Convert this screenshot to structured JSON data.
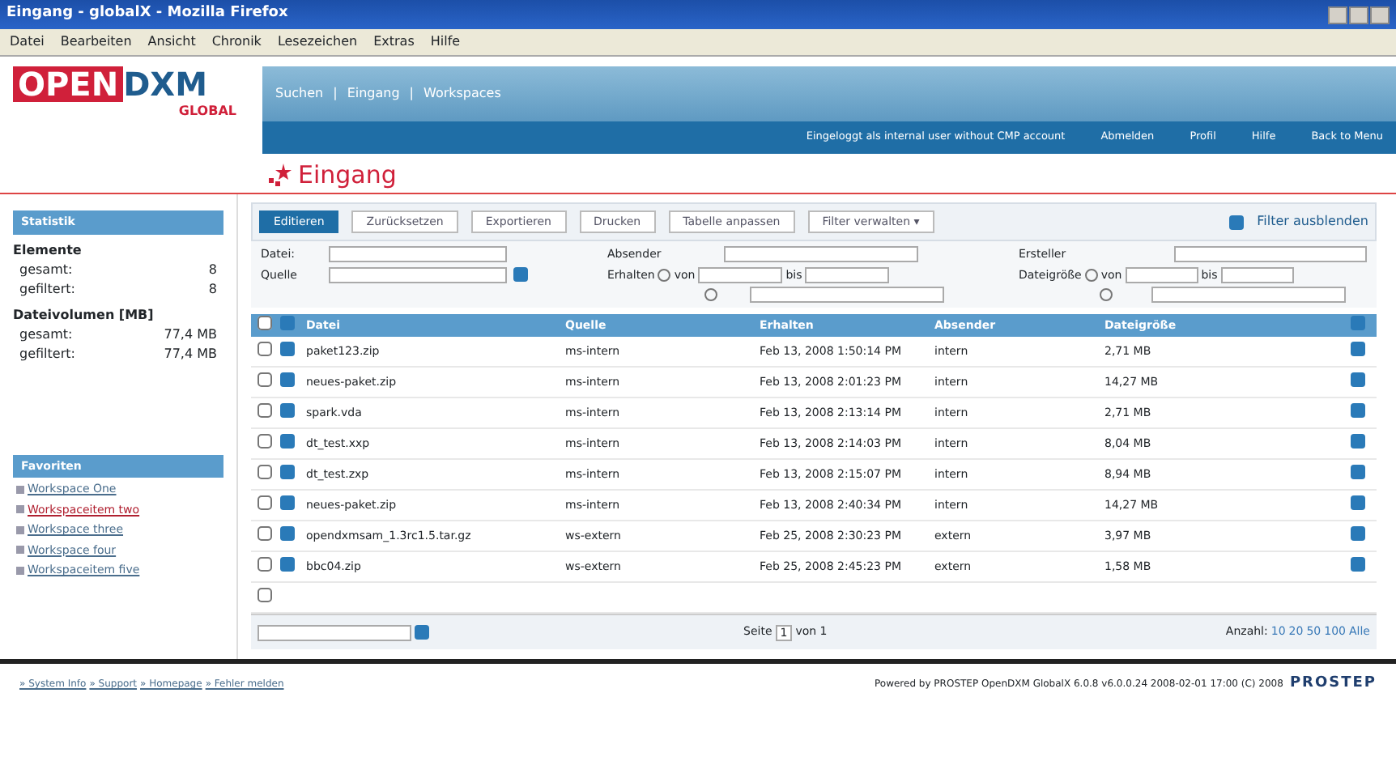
{
  "window": {
    "title": "Eingang - globalX - Mozilla Firefox"
  },
  "menu": [
    "Datei",
    "Bearbeiten",
    "Ansicht",
    "Chronik",
    "Lesezeichen",
    "Extras",
    "Hilfe"
  ],
  "logo": {
    "main": "OPEN",
    "accent": "DXM",
    "sub": "GLOBAL"
  },
  "top_nav": [
    "Suchen",
    "Eingang",
    "Workspaces"
  ],
  "top_nav_separators": [
    "|",
    "|"
  ],
  "user_bar": {
    "login": "Eingeloggt als internal user without CMP account",
    "links": [
      "Abmelden",
      "Profil",
      "Hilfe",
      "Back to Menu"
    ]
  },
  "page_title": "Eingang",
  "sidebar": {
    "statistics": {
      "title": "Statistik",
      "groups": [
        {
          "label": "Elemente",
          "rows": [
            {
              "label": "gesamt:",
              "value": "8"
            },
            {
              "label": "gefiltert:",
              "value": "8"
            }
          ]
        },
        {
          "label": "Dateivolumen [MB]",
          "rows": [
            {
              "label": "gesamt:",
              "value": "77,4 MB"
            },
            {
              "label": "gefiltert:",
              "value": "77,4 MB"
            }
          ]
        }
      ]
    },
    "favorites": {
      "title": "Favoriten",
      "items": [
        {
          "label": "Workspace One",
          "selected": false
        },
        {
          "label": "Workspaceitem two",
          "selected": true
        },
        {
          "label": "Workspace three",
          "selected": false
        },
        {
          "label": "Workspace four",
          "selected": false
        },
        {
          "label": "Workspaceitem five",
          "selected": false
        }
      ]
    }
  },
  "toolbar": {
    "buttons": [
      {
        "label": "Editieren",
        "selected": true
      },
      {
        "label": "Zurücksetzen",
        "selected": false
      },
      {
        "label": "Exportieren",
        "selected": false
      },
      {
        "label": "Drucken",
        "selected": false
      },
      {
        "label": "Tabelle anpassen",
        "selected": false
      },
      {
        "label": "Filter verwalten ▾",
        "selected": false
      }
    ],
    "toggle": "Filter ausblenden"
  },
  "filters": {
    "datei": "Datei:",
    "quelle": "Quelle",
    "absender": "Absender",
    "erhalten": "Erhalten",
    "von": "von",
    "bis": "bis",
    "ersteller": "Ersteller",
    "dateigroesse": "Dateigröße",
    "groesse_von": "von",
    "groesse_bis": "bis",
    "erhalten_radios": [
      {
        "selected": false
      },
      {
        "selected": false
      }
    ],
    "groesse_radios": [
      {
        "selected": false
      },
      {
        "selected": false
      }
    ]
  },
  "table": {
    "select_all_checked": false,
    "empty_row_checked": false,
    "columns": [
      "Datei",
      "Quelle",
      "Erhalten",
      "Absender",
      "Dateigröße"
    ],
    "rows": [
      {
        "checked": false,
        "cells": [
          "paket123.zip",
          "ms-intern",
          "Feb 13, 2008 1:50:14 PM",
          "intern",
          "2,71 MB"
        ]
      },
      {
        "checked": false,
        "cells": [
          "neues-paket.zip",
          "ms-intern",
          "Feb 13, 2008 2:01:23 PM",
          "intern",
          "14,27 MB"
        ]
      },
      {
        "checked": false,
        "cells": [
          "spark.vda",
          "ms-intern",
          "Feb 13, 2008 2:13:14 PM",
          "intern",
          "2,71 MB"
        ]
      },
      {
        "checked": false,
        "cells": [
          "dt_test.xxp",
          "ms-intern",
          "Feb 13, 2008 2:14:03 PM",
          "intern",
          "8,04 MB"
        ]
      },
      {
        "checked": false,
        "cells": [
          "dt_test.zxp",
          "ms-intern",
          "Feb 13, 2008 2:15:07 PM",
          "intern",
          "8,94 MB"
        ]
      },
      {
        "checked": false,
        "cells": [
          "neues-paket.zip",
          "ms-intern",
          "Feb 13, 2008 2:40:34 PM",
          "intern",
          "14,27 MB"
        ]
      },
      {
        "checked": false,
        "cells": [
          "opendxmsam_1.3rc1.5.tar.gz",
          "ws-extern",
          "Feb 25, 2008 2:30:23 PM",
          "extern",
          "3,97 MB"
        ]
      },
      {
        "checked": false,
        "cells": [
          "bbc04.zip",
          "ws-extern",
          "Feb 25, 2008 2:45:23 PM",
          "extern",
          "1,58 MB"
        ]
      }
    ]
  },
  "pager": {
    "page_label": "Seite",
    "page": "1",
    "of": "von 1",
    "count_label": "Anzahl:",
    "sizes": [
      "10",
      "20",
      "50",
      "100",
      "Alle"
    ]
  },
  "footer": {
    "links": [
      "» System Info",
      "» Support",
      "» Homepage",
      "» Fehler melden"
    ],
    "powered": "Powered by PROSTEP OpenDXM GlobalX 6.0.8 v6.0.0.24 2008-02-01 17:00 (C) 2008",
    "brand": "PROSTEP"
  }
}
